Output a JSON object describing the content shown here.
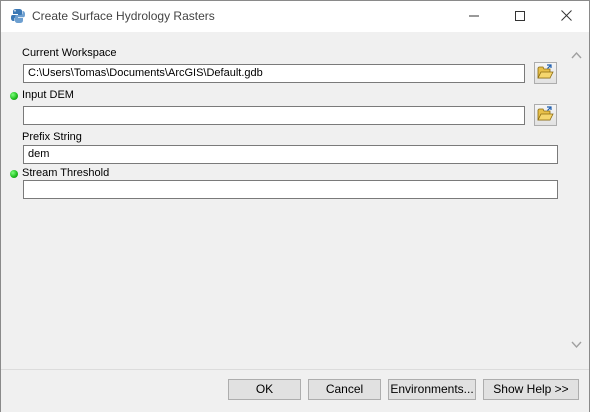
{
  "window": {
    "title": "Create Surface Hydrology Rasters",
    "title_icon": "python-script-tool-icon",
    "controls": [
      "minimize-icon",
      "maximize-icon",
      "close-icon"
    ]
  },
  "parameters": [
    {
      "label": "Current Workspace",
      "value": "C:\\Users\\Tomas\\Documents\\ArcGIS\\Default.gdb",
      "required": false,
      "has_browse": true
    },
    {
      "label": "Input DEM",
      "value": "",
      "required": true,
      "has_browse": true
    },
    {
      "label": "Prefix String",
      "value": "dem",
      "required": false,
      "has_browse": false
    },
    {
      "label": "Stream Threshold",
      "value": "",
      "required": true,
      "has_browse": false
    }
  ],
  "buttons": {
    "ok": "OK",
    "cancel": "Cancel",
    "environments": "Environments...",
    "show_help": "Show Help >>"
  },
  "colors": {
    "required_indicator": "#22c022",
    "dialog_background": "#f0f0f0",
    "field_border": "#7a7a7a"
  }
}
